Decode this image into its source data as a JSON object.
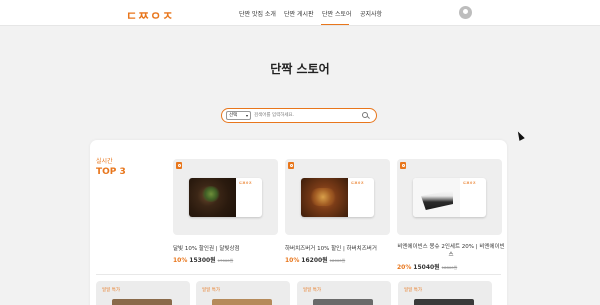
{
  "header": {
    "logo": "ㄷㅉㅇㅈ",
    "nav": [
      {
        "label": "단짠 맛집 소개",
        "active": false
      },
      {
        "label": "단짠 게시판",
        "active": false
      },
      {
        "label": "단짠 스토어",
        "active": true
      },
      {
        "label": "공지사항",
        "active": false
      }
    ],
    "accent": "#e8761c"
  },
  "page": {
    "title": "단짝 스토어"
  },
  "search": {
    "select_value": "선택",
    "placeholder": "검색어를 입력하세요."
  },
  "realtime": {
    "label": "실시간",
    "heading": "TOP 3",
    "products": [
      {
        "name": "달빛 10% 할인권 | 달빛상점",
        "discount": "10%",
        "price": "15300원",
        "original": "17000원",
        "photo": "food-dark-noodles"
      },
      {
        "name": "하버치즈버거 10% 할인 | 하버치즈버거",
        "discount": "10%",
        "price": "16200원",
        "original": "18000원",
        "photo": "food-burger-fries"
      },
      {
        "name": "비엔에이빈스 몽슈 2인세트 20% | 비엔에이빈스",
        "discount": "20%",
        "price": "15040원",
        "original": "18800원",
        "photo": "dessert-cake"
      }
    ],
    "gift_logo": "ㄷㅉㅇㅈ"
  },
  "daily": {
    "items": [
      {
        "label": "일일 특가"
      },
      {
        "label": "일일 특가"
      },
      {
        "label": "일일 특가"
      },
      {
        "label": "일일 특가"
      }
    ]
  }
}
